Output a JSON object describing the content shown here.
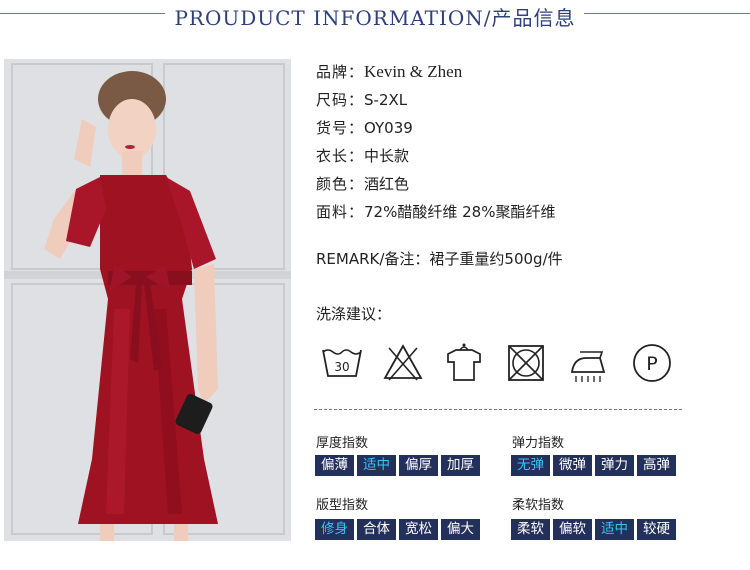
{
  "header": {
    "title": "PROUDUCT INFORMATION/产品信息"
  },
  "specs": [
    {
      "key": "品牌：",
      "value": "Kevin & Zhen"
    },
    {
      "key": "尺码：",
      "value": "S-2XL"
    },
    {
      "key": "货号：",
      "value": "OY039"
    },
    {
      "key": "衣长：",
      "value": "中长款"
    },
    {
      "key": "颜色：",
      "value": "酒红色"
    },
    {
      "key": "面料：",
      "value": "72%醋酸纤维 28%聚酯纤维"
    }
  ],
  "remark": {
    "key": "REMARK/备注：",
    "value": "裙子重量约500g/件"
  },
  "washing": {
    "label": "洗涤建议：",
    "icons": [
      "wash-30-icon",
      "do-not-bleach-icon",
      "hang-dry-icon",
      "do-not-tumble-dry-icon",
      "iron-icon",
      "professional-dry-clean-p-icon"
    ],
    "wash_temp": "30",
    "dryclean_letter": "P"
  },
  "indices": [
    {
      "title": "厚度指数",
      "options": [
        "偏薄",
        "适中",
        "偏厚",
        "加厚"
      ],
      "selected": 1
    },
    {
      "title": "弹力指数",
      "options": [
        "无弹",
        "微弹",
        "弹力",
        "高弹"
      ],
      "selected": 0
    },
    {
      "title": "版型指数",
      "options": [
        "修身",
        "合体",
        "宽松",
        "偏大"
      ],
      "selected": 0
    },
    {
      "title": "柔软指数",
      "options": [
        "柔软",
        "偏软",
        "适中",
        "较硬"
      ],
      "selected": 2
    }
  ],
  "colors": {
    "navy": "#23305a",
    "selected_text": "#39c3f3",
    "dress_red": "#9e1222",
    "header_blue": "#2e3f7a"
  }
}
